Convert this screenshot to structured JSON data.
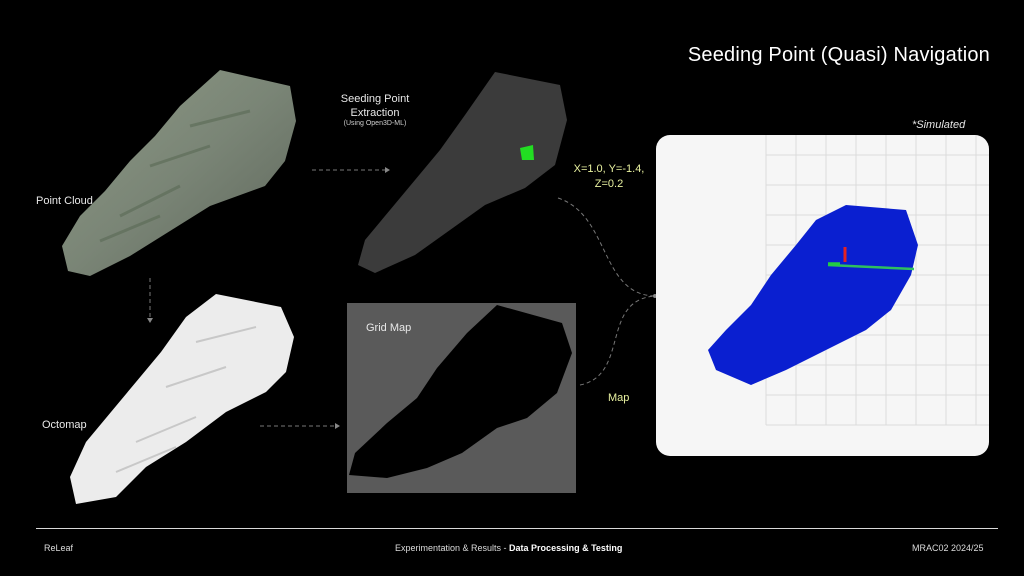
{
  "header": {
    "title": "Seeding Point (Quasi) Navigation"
  },
  "labels": {
    "point_cloud": "Point Cloud",
    "octomap": "Octomap",
    "seeding_title_line1": "Seeding Point",
    "seeding_title_line2": "Extraction",
    "seeding_subtitle": "(Using Open3D-ML)",
    "grid_map": "Grid Map",
    "coords_line1": "X=1.0, Y=-1.4,",
    "coords_line2": "Z=0.2",
    "map": "Map",
    "simulated": "*Simulated"
  },
  "footer": {
    "left": "ReLeaf",
    "center_prefix": "Experimentation & Results - ",
    "center_bold": "Data Processing & Testing",
    "right": "MRAC02 2024/25"
  },
  "colors": {
    "background": "#000000",
    "seed_point": "#22dd22",
    "sim_map_blue": "#0a1fd0",
    "coords_text": "#e9f2a0"
  },
  "icons": [
    "dashed-arrow-icon"
  ]
}
